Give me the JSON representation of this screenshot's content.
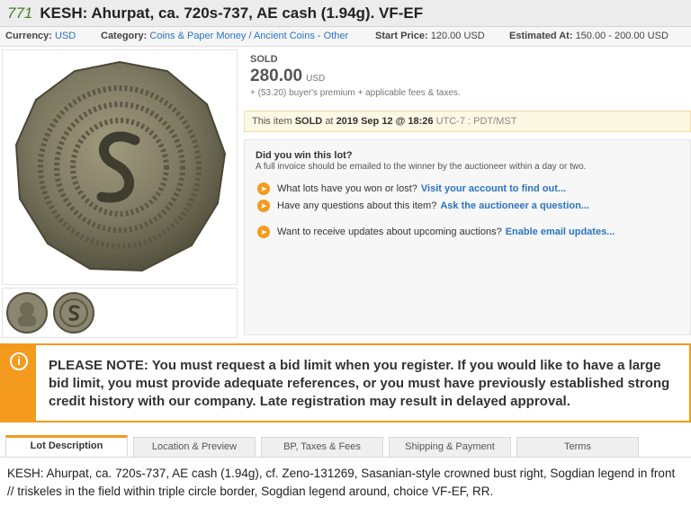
{
  "header": {
    "lot_number": "771",
    "lot_title": "KESH: Ahurpat, ca. 720s-737, AE cash (1.94g). VF-EF"
  },
  "info_bar": {
    "currency_label": "Currency:",
    "currency_value": "USD",
    "category_label": "Category:",
    "category_value": "Coins & Paper Money / Ancient Coins - Other",
    "start_price_label": "Start Price:",
    "start_price_value": "120.00 USD",
    "estimated_label": "Estimated At:",
    "estimated_value": "150.00 - 200.00 USD"
  },
  "sale": {
    "status": "SOLD",
    "price": "280.00",
    "currency": "USD",
    "premium": "+ (53.20) buyer's premium + applicable fees & taxes."
  },
  "sold_notice": {
    "prefix": "This item",
    "sold": "SOLD",
    "at": "at",
    "datetime": "2019 Sep 12 @ 18:26",
    "timezone": "UTC-7 : PDT/MST"
  },
  "win_panel": {
    "question": "Did you win this lot?",
    "subtext": "A full invoice should be emailed to the winner by the auctioneer within a day or two.",
    "items": [
      {
        "text": "What lots have you won or lost?",
        "link": "Visit your account to find out..."
      },
      {
        "text": "Have any questions about this item?",
        "link": "Ask the auctioneer a question..."
      },
      {
        "text": "Want to receive updates about upcoming auctions?",
        "link": "Enable email updates..."
      }
    ]
  },
  "notice": {
    "icon": "info-icon",
    "bold": "PLEASE NOTE:",
    "text": "You must request a bid limit when you register. If you would like to have a large bid limit, you must provide adequate references, or you must have previously established strong credit history with our company. Late registration may result in delayed approval."
  },
  "tabs": [
    {
      "label": "Lot Description"
    },
    {
      "label": "Location & Preview"
    },
    {
      "label": "BP, Taxes & Fees"
    },
    {
      "label": "Shipping & Payment"
    },
    {
      "label": "Terms"
    }
  ],
  "description": "KESH: Ahurpat, ca. 720s-737, AE cash (1.94g), cf. Zeno-131269, Sasanian-style crowned bust right, Sogdian legend in front // triskeles in the field within triple circle border, Sogdian legend around, choice VF-EF, RR.",
  "colors": {
    "accent_orange": "#f39a1f",
    "link_blue": "#2a74c2",
    "lot_number_green": "#4a7f2a"
  }
}
